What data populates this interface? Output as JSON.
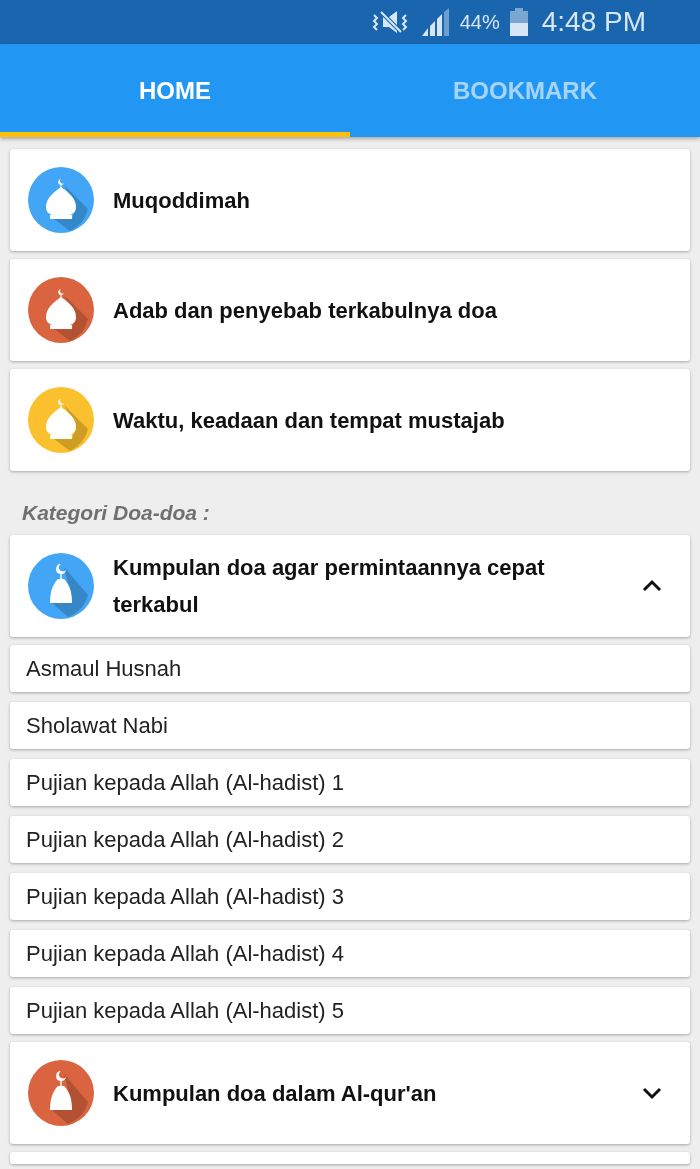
{
  "status_bar": {
    "battery": "44%",
    "time": "4:48 PM"
  },
  "tabs": [
    {
      "label": "HOME",
      "selected": true
    },
    {
      "label": "BOOKMARK",
      "selected": false
    }
  ],
  "menu_items": [
    {
      "title": "Muqoddimah",
      "color": "#42a5f5"
    },
    {
      "title": "Adab dan penyebab terkabulnya doa",
      "color": "#d9643f"
    },
    {
      "title": "Waktu, keadaan dan tempat mustajab",
      "color": "#fbc02d"
    }
  ],
  "section_label": "Kategori Doa-doa :",
  "categories": [
    {
      "title": "Kumpulan doa agar permintaannya cepat terkabul",
      "color": "#42a5f5",
      "expanded": true,
      "items": [
        "Asmaul Husnah",
        "Sholawat Nabi",
        "Pujian kepada Allah (Al-hadist) 1",
        "Pujian kepada Allah (Al-hadist) 2",
        "Pujian kepada Allah (Al-hadist) 3",
        "Pujian kepada Allah (Al-hadist) 4",
        "Pujian kepada Allah (Al-hadist) 5"
      ]
    },
    {
      "title": "Kumpulan doa dalam Al-qur'an",
      "color": "#d9643f",
      "expanded": false
    }
  ]
}
